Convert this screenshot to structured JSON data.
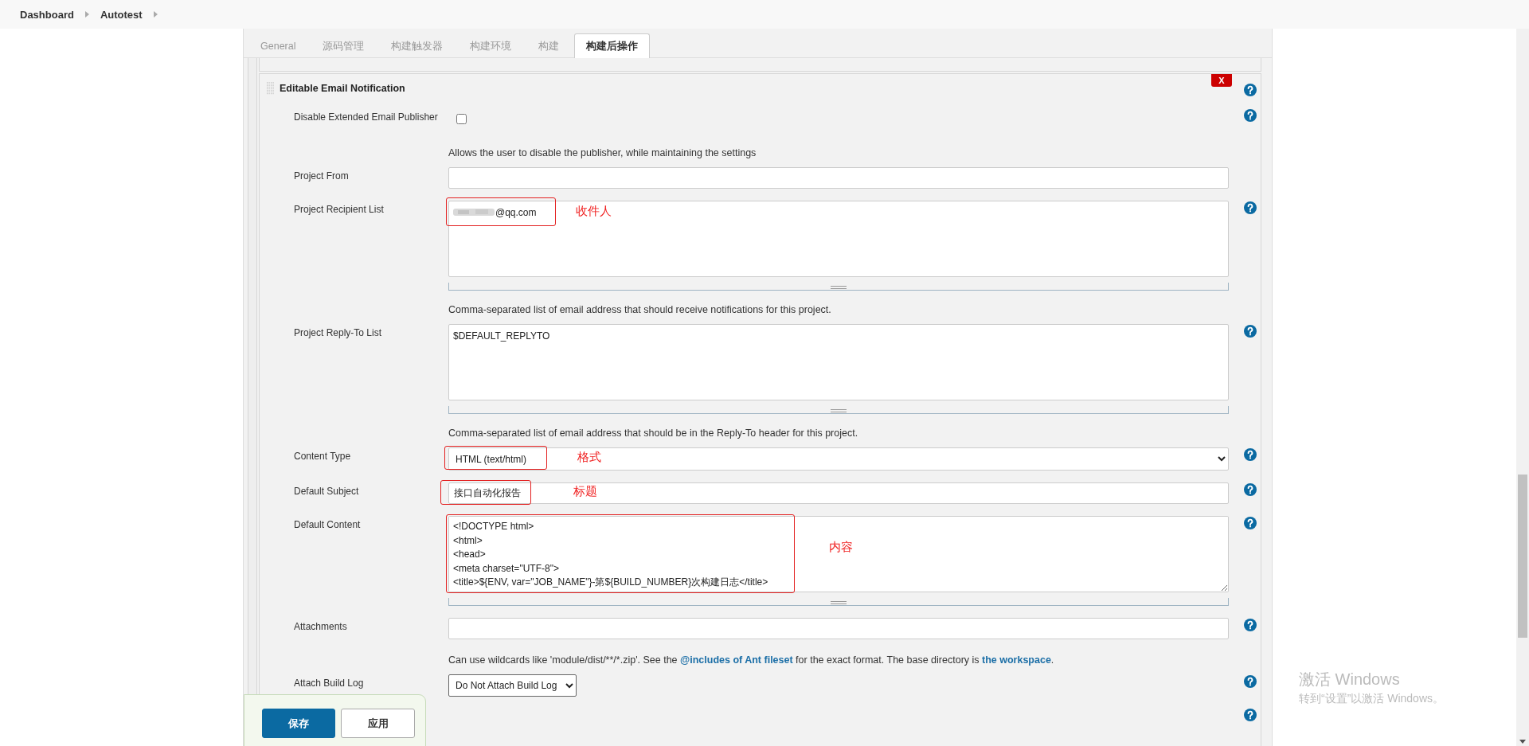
{
  "breadcrumb": [
    {
      "label": "Dashboard"
    },
    {
      "label": "Autotest"
    }
  ],
  "tabs": [
    {
      "label": "General",
      "selected": false
    },
    {
      "label": "源码管理",
      "selected": false
    },
    {
      "label": "构建触发器",
      "selected": false
    },
    {
      "label": "构建环境",
      "selected": false
    },
    {
      "label": "构建",
      "selected": false
    },
    {
      "label": "构建后操作",
      "selected": true
    }
  ],
  "section": {
    "title": "Editable Email Notification",
    "delete_label": "X",
    "help": true
  },
  "rows": [
    {
      "kind": "checkbox",
      "label": "Disable Extended Email Publisher",
      "checked": false,
      "help": true
    },
    {
      "kind": "description",
      "parts": [
        {
          "kind": "text",
          "text": "Allows the user to disable the publisher, while maintaining the settings"
        }
      ]
    },
    {
      "kind": "text",
      "label": "Project From",
      "value": "",
      "help": false
    },
    {
      "kind": "textarea",
      "label": "Project Recipient List",
      "value": "@qq.com",
      "redacted": true,
      "annotation": "收件人",
      "help": true
    },
    {
      "kind": "description",
      "parts": [
        {
          "kind": "text",
          "text": "Comma-separated list of email address that should receive notifications for this project."
        }
      ]
    },
    {
      "kind": "textarea",
      "label": "Project Reply-To List",
      "value": "$DEFAULT_REPLYTO",
      "help": true
    },
    {
      "kind": "description",
      "parts": [
        {
          "kind": "text",
          "text": "Comma-separated list of email address that should be in the Reply-To header for this project."
        }
      ]
    },
    {
      "kind": "select",
      "label": "Content Type",
      "value": "HTML (text/html)",
      "annotation": "格式",
      "help": true
    },
    {
      "kind": "text",
      "label": "Default Subject",
      "value": "接口自动化报告",
      "annotation": "标题",
      "help": true
    },
    {
      "kind": "code",
      "label": "Default Content",
      "lines": [
        "<!DOCTYPE html>",
        "<html>",
        "<head>",
        "<meta charset=\"UTF-8\">",
        "<title>${ENV, var=\"JOB_NAME\"}-第${BUILD_NUMBER}次构建日志</title>"
      ],
      "annotation": "内容",
      "help": true
    },
    {
      "kind": "text",
      "label": "Attachments",
      "value": "",
      "help": true
    },
    {
      "kind": "description",
      "parts": [
        {
          "kind": "text",
          "text": "Can use wildcards like 'module/dist/**/*.zip'. See the "
        },
        {
          "kind": "link",
          "text": "@includes of Ant fileset"
        },
        {
          "kind": "text",
          "text": " for the exact format. The base directory is "
        },
        {
          "kind": "link",
          "text": "the workspace"
        },
        {
          "kind": "text",
          "text": "."
        }
      ]
    },
    {
      "kind": "small_select",
      "label": "Attach Build Log",
      "value": "Do Not Attach Build Log",
      "help": true
    },
    {
      "kind": "blank",
      "help": true
    }
  ],
  "save_bar": {
    "buttons": [
      {
        "label": "保存",
        "primary": true
      },
      {
        "label": "应用",
        "primary": false
      }
    ]
  },
  "os_notice": {
    "title": "激活 Windows",
    "subtitle": "转到“设置”以激活 Windows。"
  }
}
